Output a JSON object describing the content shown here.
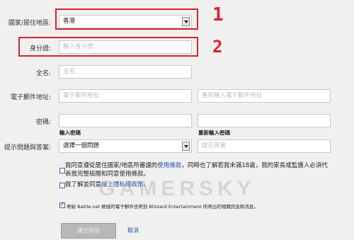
{
  "annotations": {
    "one": "1",
    "two": "2"
  },
  "colors": {
    "highlight": "#d8232a",
    "link": "#1f4fa8",
    "background": "#f1f0f1"
  },
  "form": {
    "country": {
      "label": "國家/居住地區:",
      "value": "香港"
    },
    "id_number": {
      "label": "身分證:",
      "placeholder": "輸入身分證:"
    },
    "full_name": {
      "label": "全名:",
      "placeholder": "全名"
    },
    "email": {
      "label": "電子郵件地址:",
      "placeholder": "電子郵件地址",
      "confirm_placeholder": "重新輸入電子郵件地址"
    },
    "password": {
      "label": "密碼:",
      "caption": "輸入密碼",
      "confirm_caption": "重新輸入密碼"
    },
    "security_question": {
      "label": "提示問題與答案:",
      "value": "選擇一個問題",
      "answer_placeholder": "提示答案"
    }
  },
  "agreements": {
    "terms": {
      "text_before": "我同意遵從居住國家/地區所審議的",
      "link": "使用條款",
      "text_after": "，同時也了解若我未滿18歲，我的家長或監護人必須代表我完整檢閱和同意使用條款。"
    },
    "privacy": {
      "text_before": "我了解並同意",
      "link": "線上隱私權政策",
      "text_after": "。"
    },
    "newsletter": {
      "text": "寄給 Battle.net 帳號的電子郵件也寄到 Blizzard Entertainment 所寄出的相關訊息和消息。"
    }
  },
  "actions": {
    "submit_label": "建立帳號",
    "cancel_label": "取消"
  },
  "watermark": "GAMERSKY"
}
